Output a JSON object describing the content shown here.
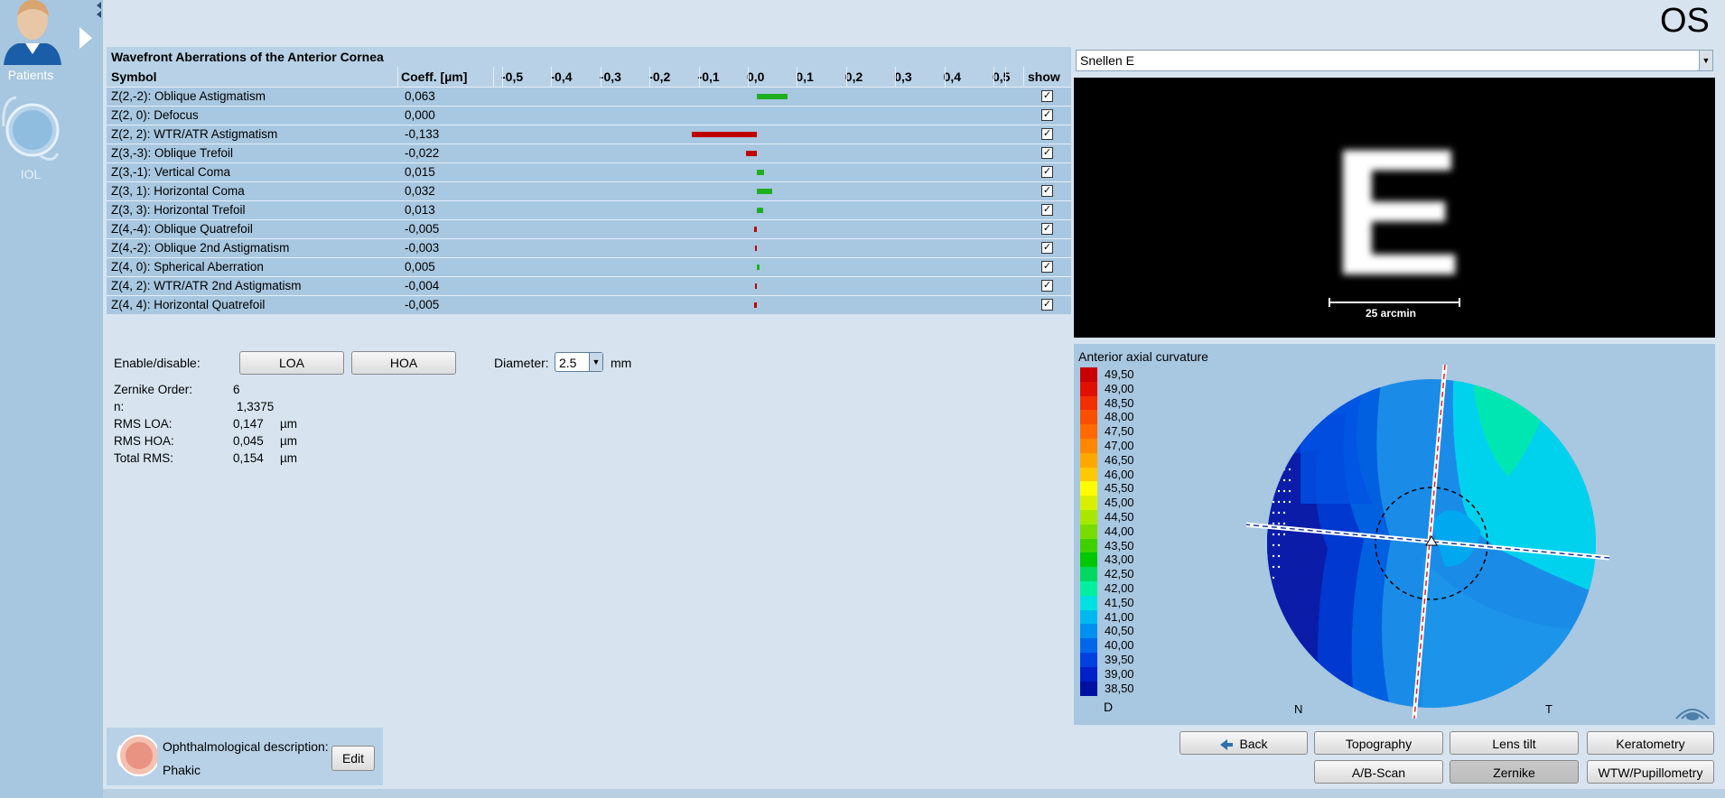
{
  "nav": {
    "patients_label": "Patients",
    "iol_label": "IOL"
  },
  "header": {
    "eye": "OS"
  },
  "wavefront": {
    "title": "Wavefront Aberrations of the Anterior Cornea",
    "columns": {
      "symbol": "Symbol",
      "coeff": "Coeff. [µm]",
      "show": "show"
    },
    "axis_ticks": [
      "-0,5",
      "-0,4",
      "-0,3",
      "-0,2",
      "-0,1",
      "0,0",
      "0,1",
      "0,2",
      "0,3",
      "0,4",
      "0,5"
    ],
    "rows": [
      {
        "symbol": "Z(2,-2): Oblique Astigmatism",
        "coeff": "0,063",
        "value": 0.063,
        "show": true
      },
      {
        "symbol": "Z(2, 0): Defocus",
        "coeff": "0,000",
        "value": 0.0,
        "show": true
      },
      {
        "symbol": "Z(2, 2): WTR/ATR Astigmatism",
        "coeff": "-0,133",
        "value": -0.133,
        "show": true
      },
      {
        "symbol": "Z(3,-3): Oblique Trefoil",
        "coeff": "-0,022",
        "value": -0.022,
        "show": true
      },
      {
        "symbol": "Z(3,-1): Vertical Coma",
        "coeff": "0,015",
        "value": 0.015,
        "show": true
      },
      {
        "symbol": "Z(3, 1): Horizontal Coma",
        "coeff": "0,032",
        "value": 0.032,
        "show": true
      },
      {
        "symbol": "Z(3, 3): Horizontal Trefoil",
        "coeff": "0,013",
        "value": 0.013,
        "show": true
      },
      {
        "symbol": "Z(4,-4): Oblique Quatrefoil",
        "coeff": "-0,005",
        "value": -0.005,
        "show": true
      },
      {
        "symbol": "Z(4,-2): Oblique 2nd Astigmatism",
        "coeff": "-0,003",
        "value": -0.003,
        "show": true
      },
      {
        "symbol": "Z(4, 0): Spherical Aberration",
        "coeff": "0,005",
        "value": 0.005,
        "show": true
      },
      {
        "symbol": "Z(4, 2): WTR/ATR 2nd Astigmatism",
        "coeff": "-0,004",
        "value": -0.004,
        "show": true
      },
      {
        "symbol": "Z(4, 4): Horizontal Quatrefoil",
        "coeff": "-0,005",
        "value": -0.005,
        "show": true
      }
    ],
    "positive_color": "#1fae1f",
    "negative_color": "#c00000"
  },
  "controls": {
    "enable_label": "Enable/disable:",
    "loa_label": "LOA",
    "hoa_label": "HOA",
    "diameter_label": "Diameter:",
    "diameter_value": "2.5",
    "diameter_unit": "mm"
  },
  "info": {
    "zernike_order_label": "Zernike Order:",
    "zernike_order_value": "6",
    "n_label": "n:",
    "n_value": "1,3375",
    "rms_loa_label": "RMS LOA:",
    "rms_loa_value": "0,147",
    "rms_loa_unit": "µm",
    "rms_hoa_label": "RMS HOA:",
    "rms_hoa_value": "0,045",
    "rms_hoa_unit": "µm",
    "total_rms_label": "Total RMS:",
    "total_rms_value": "0,154",
    "total_rms_unit": "µm"
  },
  "ophthalmo": {
    "title": "Ophthalmological description:",
    "value": "Phakic",
    "edit_label": "Edit"
  },
  "snellen": {
    "selected": "Snellen E",
    "letter": "E",
    "scale_label": "25 arcmin"
  },
  "curvature": {
    "title": "Anterior axial curvature",
    "unit": "D",
    "nasal_label": "N",
    "temporal_label": "T",
    "legend": [
      {
        "label": "49,50",
        "color": "#c80000"
      },
      {
        "label": "49,00",
        "color": "#e01000"
      },
      {
        "label": "48,50",
        "color": "#f03000"
      },
      {
        "label": "48,00",
        "color": "#f85000"
      },
      {
        "label": "47,50",
        "color": "#ff6a00"
      },
      {
        "label": "47,00",
        "color": "#ff8800"
      },
      {
        "label": "46,50",
        "color": "#ffa800"
      },
      {
        "label": "46,00",
        "color": "#ffc800"
      },
      {
        "label": "45,50",
        "color": "#ffff00"
      },
      {
        "label": "45,00",
        "color": "#d8f000"
      },
      {
        "label": "44,50",
        "color": "#a8e800"
      },
      {
        "label": "44,00",
        "color": "#78dc00"
      },
      {
        "label": "43,50",
        "color": "#40d000"
      },
      {
        "label": "43,00",
        "color": "#00c800"
      },
      {
        "label": "42,50",
        "color": "#00d860"
      },
      {
        "label": "42,00",
        "color": "#00f0a0"
      },
      {
        "label": "41,50",
        "color": "#00e0e0"
      },
      {
        "label": "41,00",
        "color": "#00b8f0"
      },
      {
        "label": "40,50",
        "color": "#0090f0"
      },
      {
        "label": "40,00",
        "color": "#0068e8"
      },
      {
        "label": "39,50",
        "color": "#0040e0"
      },
      {
        "label": "39,00",
        "color": "#0020c8"
      },
      {
        "label": "38,50",
        "color": "#0010a0"
      }
    ]
  },
  "buttons": {
    "back": "Back",
    "topography": "Topography",
    "lens_tilt": "Lens tilt",
    "keratometry": "Keratometry",
    "ab_scan": "A/B-Scan",
    "zernike": "Zernike",
    "wtw": "WTW/Pupillometry"
  }
}
